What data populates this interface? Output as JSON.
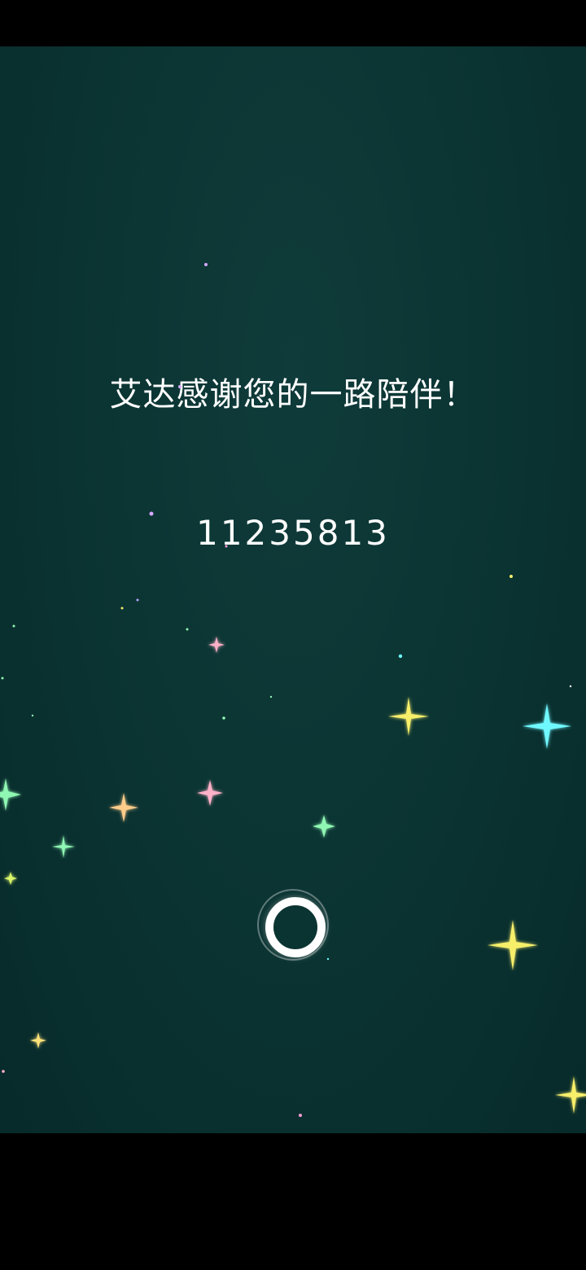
{
  "screen": {
    "message": "艾达感谢您的一路陪伴！",
    "code": "11235813"
  },
  "actions": {
    "circle_icon": "circle-ring-icon"
  },
  "colors": {
    "background": "#0b3533",
    "text": "#ffffff",
    "star_yellow": "#f7ef6a",
    "star_cyan": "#6ff8ff",
    "star_green": "#8ff7b3",
    "star_pink": "#ffb1c8",
    "star_orange": "#ffcc8a",
    "star_violet": "#d7a8ff"
  }
}
